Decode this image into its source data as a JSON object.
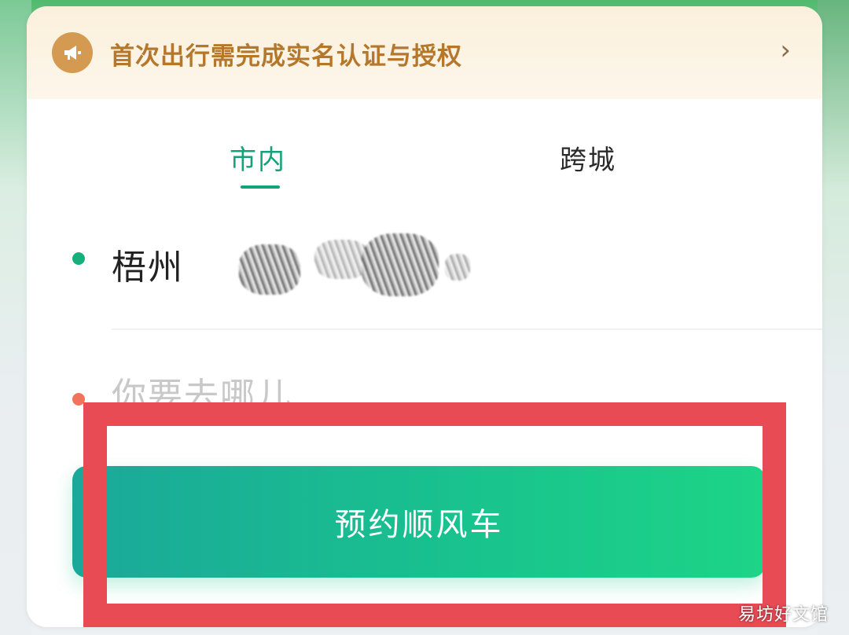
{
  "notice": {
    "text": "首次出行需完成实名认证与授权",
    "chevron": "›",
    "icon": "megaphone-icon"
  },
  "tabs": [
    {
      "label": "市内",
      "active": true
    },
    {
      "label": "跨城",
      "active": false
    }
  ],
  "route": {
    "from_city": "梧州",
    "to_placeholder": "你要去哪儿"
  },
  "book_button": {
    "label": "预约顺风车"
  },
  "watermark": "易坊好文馆",
  "colors": {
    "accent": "#13a27a",
    "button_start": "#1aa89a",
    "button_end": "#1dd487",
    "highlight": "#e94b55",
    "notice_text": "#b5772b"
  }
}
